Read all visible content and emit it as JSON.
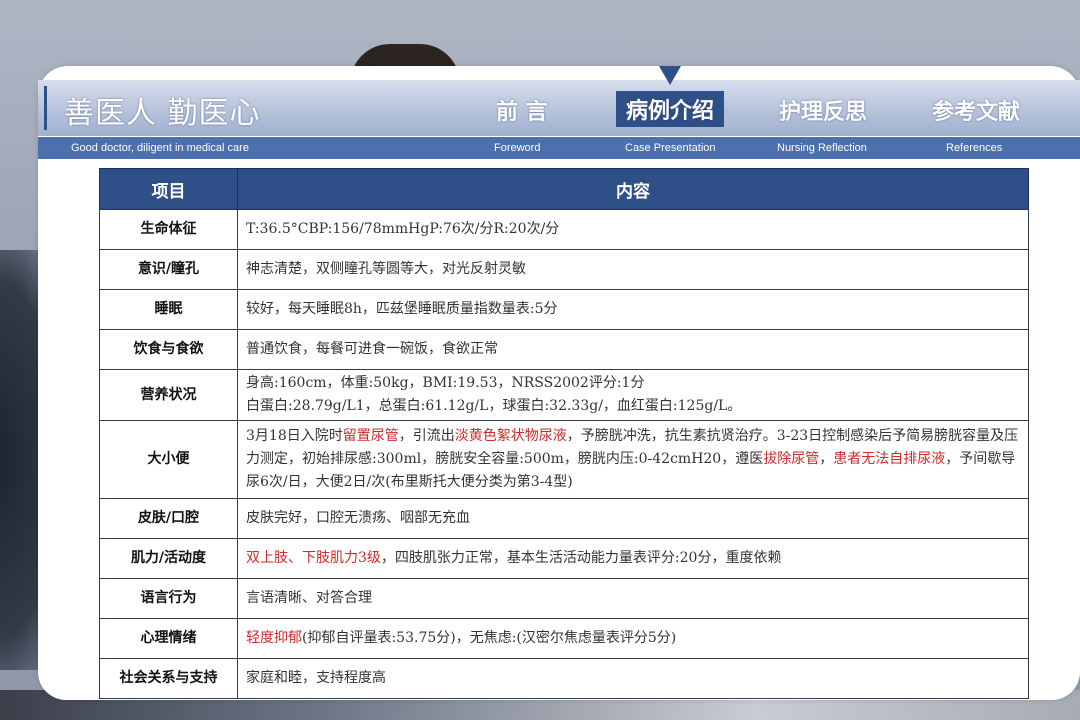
{
  "header": {
    "slogan": "善医人 勤医心",
    "slogan_en": "Good doctor, diligent in medical care",
    "nav": [
      {
        "label": "前 言",
        "label_en": "Foreword"
      },
      {
        "label": "病例介绍",
        "label_en": "Case Presentation"
      },
      {
        "label": "护理反思",
        "label_en": "Nursing Reflection"
      },
      {
        "label": "参考文献",
        "label_en": "References"
      }
    ],
    "active_nav_index": 1,
    "accent_color": "#2f4f88"
  },
  "table": {
    "headers": [
      "项目",
      "内容"
    ],
    "rows": [
      {
        "label": "生命体征",
        "parts": [
          {
            "t": "T:36.5°CBP:156/78mmHgP:76次/分R:20次/分"
          }
        ]
      },
      {
        "label": "意识/瞳孔",
        "parts": [
          {
            "t": "神志清楚，双侧瞳孔等圆等大，对光反射灵敏"
          }
        ]
      },
      {
        "label": "睡眠",
        "parts": [
          {
            "t": "较好，每天睡眠8h，匹兹堡睡眠质量指数量表:5分"
          }
        ]
      },
      {
        "label": "饮食与食欲",
        "parts": [
          {
            "t": "普通饮食，每餐可进食一碗饭，食欲正常"
          }
        ]
      },
      {
        "label": "营养状况",
        "parts": [
          {
            "t": "身高:160cm，体重:50kg，BMI:19.53，NRSS2002评分:1分"
          },
          {
            "t": "白蛋白:28.79g/L1，总蛋白:61.12g/L，球蛋白:32.33g/，血红蛋白:125g/L。",
            "br": true
          }
        ]
      },
      {
        "label": "大小便",
        "parts": [
          {
            "t": "3月18日入院时"
          },
          {
            "t": "留置尿管",
            "red": true
          },
          {
            "t": "，引流出"
          },
          {
            "t": "淡黄色絮状物尿液",
            "red": true
          },
          {
            "t": "，予膀胱冲洗，抗生素抗贤治疗。3-23日控制感染后予简易膀胱容量及压力测定，初始排尿感:300ml，膀胱安全容量:500m，膀胱内压:0-42cmH20，遵医"
          },
          {
            "t": "拔除尿管",
            "red": true
          },
          {
            "t": "，"
          },
          {
            "t": "患者无法自排尿液",
            "red": true
          },
          {
            "t": "，予间歇导尿6次/日，大便2日/次(布里斯托大便分类为第3-4型)"
          }
        ]
      },
      {
        "label": "皮肤/口腔",
        "parts": [
          {
            "t": "皮肤完好，口腔无溃疡、咽部无充血"
          }
        ]
      },
      {
        "label": "肌力/活动度",
        "parts": [
          {
            "t": "双上肢、下肢肌力3级",
            "red": true
          },
          {
            "t": "，四肢肌张力正常，基本生活活动能力量表评分:20分，重度依赖"
          }
        ]
      },
      {
        "label": "语言行为",
        "parts": [
          {
            "t": "言语清晰、对答合理"
          }
        ]
      },
      {
        "label": "心理情绪",
        "parts": [
          {
            "t": "轻度抑郁",
            "red": true
          },
          {
            "t": "(抑郁自评量表:53.75分)，无焦虑:(汉密尔焦虑量表评分5分)"
          }
        ]
      },
      {
        "label": "社会关系与支持",
        "parts": [
          {
            "t": "家庭和睦，支持程度高"
          }
        ]
      }
    ]
  },
  "highlight_color": "#d02a2a"
}
